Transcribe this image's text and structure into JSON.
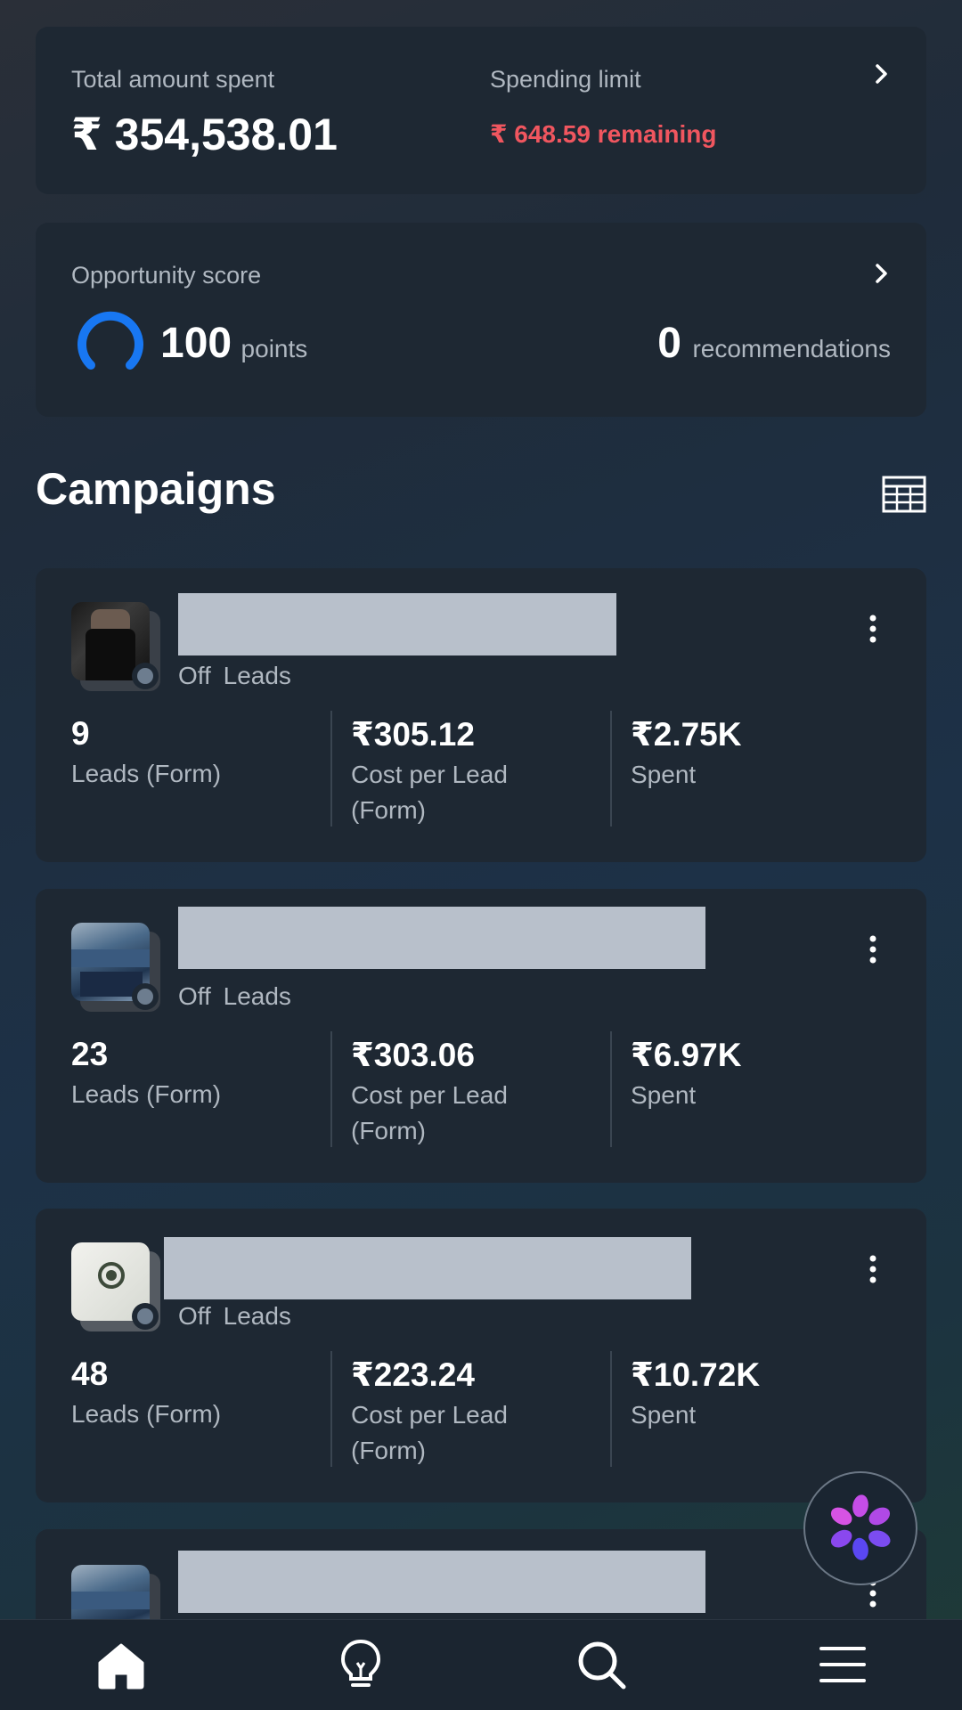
{
  "spending": {
    "total_label": "Total amount spent",
    "total_value": "₹ 354,538.01",
    "limit_label": "Spending limit",
    "limit_value": "₹ 648.59 remaining",
    "alert_color": "#f0565f"
  },
  "opportunity": {
    "label": "Opportunity score",
    "score": "100",
    "score_unit": "points",
    "recommendations_count": "0",
    "recommendations_label": "recommendations",
    "gauge_color": "#1877f2"
  },
  "campaigns": {
    "title": "Campaigns",
    "items": [
      {
        "status": "Off",
        "objective": "Leads",
        "metrics": [
          {
            "value": "9",
            "label": "Leads (Form)"
          },
          {
            "value": "₹305.12",
            "label": "Cost per Lead (Form)"
          },
          {
            "value": "₹2.75K",
            "label": "Spent"
          }
        ]
      },
      {
        "status": "Off",
        "objective": "Leads",
        "metrics": [
          {
            "value": "23",
            "label": "Leads (Form)"
          },
          {
            "value": "₹303.06",
            "label": "Cost per Lead (Form)"
          },
          {
            "value": "₹6.97K",
            "label": "Spent"
          }
        ]
      },
      {
        "status": "Off",
        "objective": "Leads",
        "metrics": [
          {
            "value": "48",
            "label": "Leads (Form)"
          },
          {
            "value": "₹223.24",
            "label": "Cost per Lead (Form)"
          },
          {
            "value": "₹10.72K",
            "label": "Spent"
          }
        ]
      }
    ]
  },
  "bottom_nav": {
    "items": [
      "home-icon",
      "lightbulb-icon",
      "search-icon",
      "menu-icon"
    ]
  },
  "fab": {
    "icon": "ai-assistant-icon"
  }
}
